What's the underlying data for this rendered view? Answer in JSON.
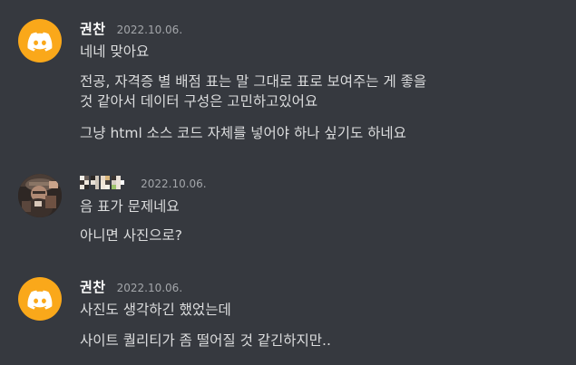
{
  "messages": [
    {
      "username": "권찬",
      "timestamp": "2022.10.06.",
      "avatar_icon": "discord-logo-icon",
      "lines": [
        "네네 맞아요",
        "전공, 자격증 별 배점 표는 말 그대로 표로 보여주는 게 좋을",
        "것 같아서 데이터 구성은 고민하고있어요",
        "그냥 html 소스 코드 자체를 넣어야 하나 싶기도 하네요"
      ]
    },
    {
      "username": "",
      "timestamp": "2022.10.06.",
      "avatar_icon": "user-photo-avatar",
      "username_icon": "pixelated-username",
      "lines": [
        "음 표가 문제네요",
        "아니면 사진으로?"
      ]
    },
    {
      "username": "권찬",
      "timestamp": "2022.10.06.",
      "avatar_icon": "discord-logo-icon",
      "lines": [
        "사진도 생각하긴 했었는데",
        "사이트 퀄리티가 좀 떨어질 것 같긴하지만.."
      ]
    }
  ],
  "colors": {
    "background": "#36393f",
    "username": "#ffffff",
    "timestamp": "#a3a6aa",
    "message_text": "#dcddde",
    "discord_avatar": "#faa81a"
  }
}
